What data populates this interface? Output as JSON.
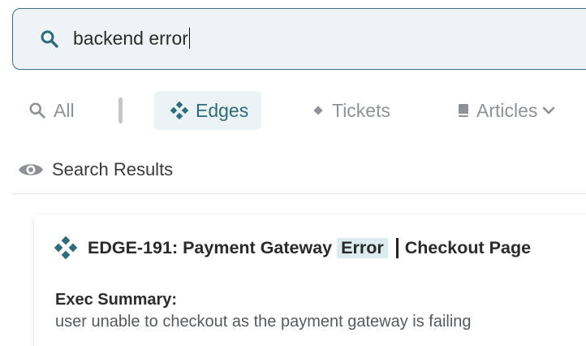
{
  "search": {
    "query": "backend error"
  },
  "filters": {
    "tabs": [
      {
        "label": "All",
        "icon": "search-icon",
        "active": false
      },
      {
        "label": "Edges",
        "icon": "edges-icon",
        "active": true
      },
      {
        "label": "Tickets",
        "icon": "diamond-icon",
        "active": false
      },
      {
        "label": "Articles",
        "icon": "book-icon",
        "active": false,
        "dropdown": true
      }
    ]
  },
  "results": {
    "header": "Search Results",
    "items": [
      {
        "title_prefix": "EDGE-191: Payment Gateway",
        "title_highlight": "Error",
        "title_suffix": "Checkout Page",
        "summary_label": "Exec Summary:",
        "summary_text": "user unable to checkout as the payment gateway is failing"
      }
    ]
  },
  "colors": {
    "accent": "#2f6b7b",
    "muted": "#8e9296",
    "highlight_bg": "#dcebf0",
    "search_bg": "#eef4f6"
  }
}
